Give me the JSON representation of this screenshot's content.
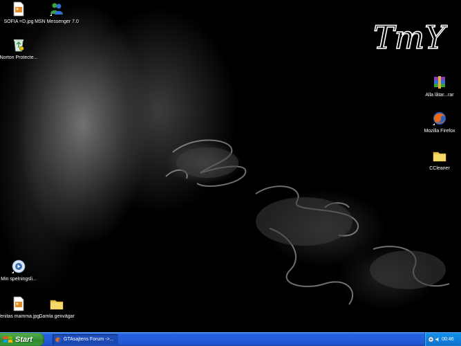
{
  "desktop": {
    "logo_text": "TmY",
    "icons": [
      {
        "label": "SOFIA =D.jpg",
        "icon": "jpg-image-icon"
      },
      {
        "label": "MSN Messenger 7.0",
        "icon": "msn-messenger-icon"
      },
      {
        "label": "Norton Protecte...",
        "icon": "norton-recycle-bin-icon"
      },
      {
        "label": "Alla låtar...rar",
        "icon": "winrar-archive-icon"
      },
      {
        "label": "Mozilla Firefox",
        "icon": "firefox-icon"
      },
      {
        "label": "CCleaner",
        "icon": "folder-icon"
      },
      {
        "label": "Min spelningsli...",
        "icon": "media-playlist-icon"
      },
      {
        "label": "Tenitas mamma.jpg",
        "icon": "jpg-image-icon"
      },
      {
        "label": "Gamla genvägar",
        "icon": "folder-icon"
      }
    ]
  },
  "taskbar": {
    "start_label": "Start",
    "task_item_label": "GTAsajtens Forum ->...",
    "clock": "00:46"
  },
  "colors": {
    "taskbar_blue": "#245edb",
    "start_green": "#3c963a",
    "tray_blue": "#0f82de"
  }
}
